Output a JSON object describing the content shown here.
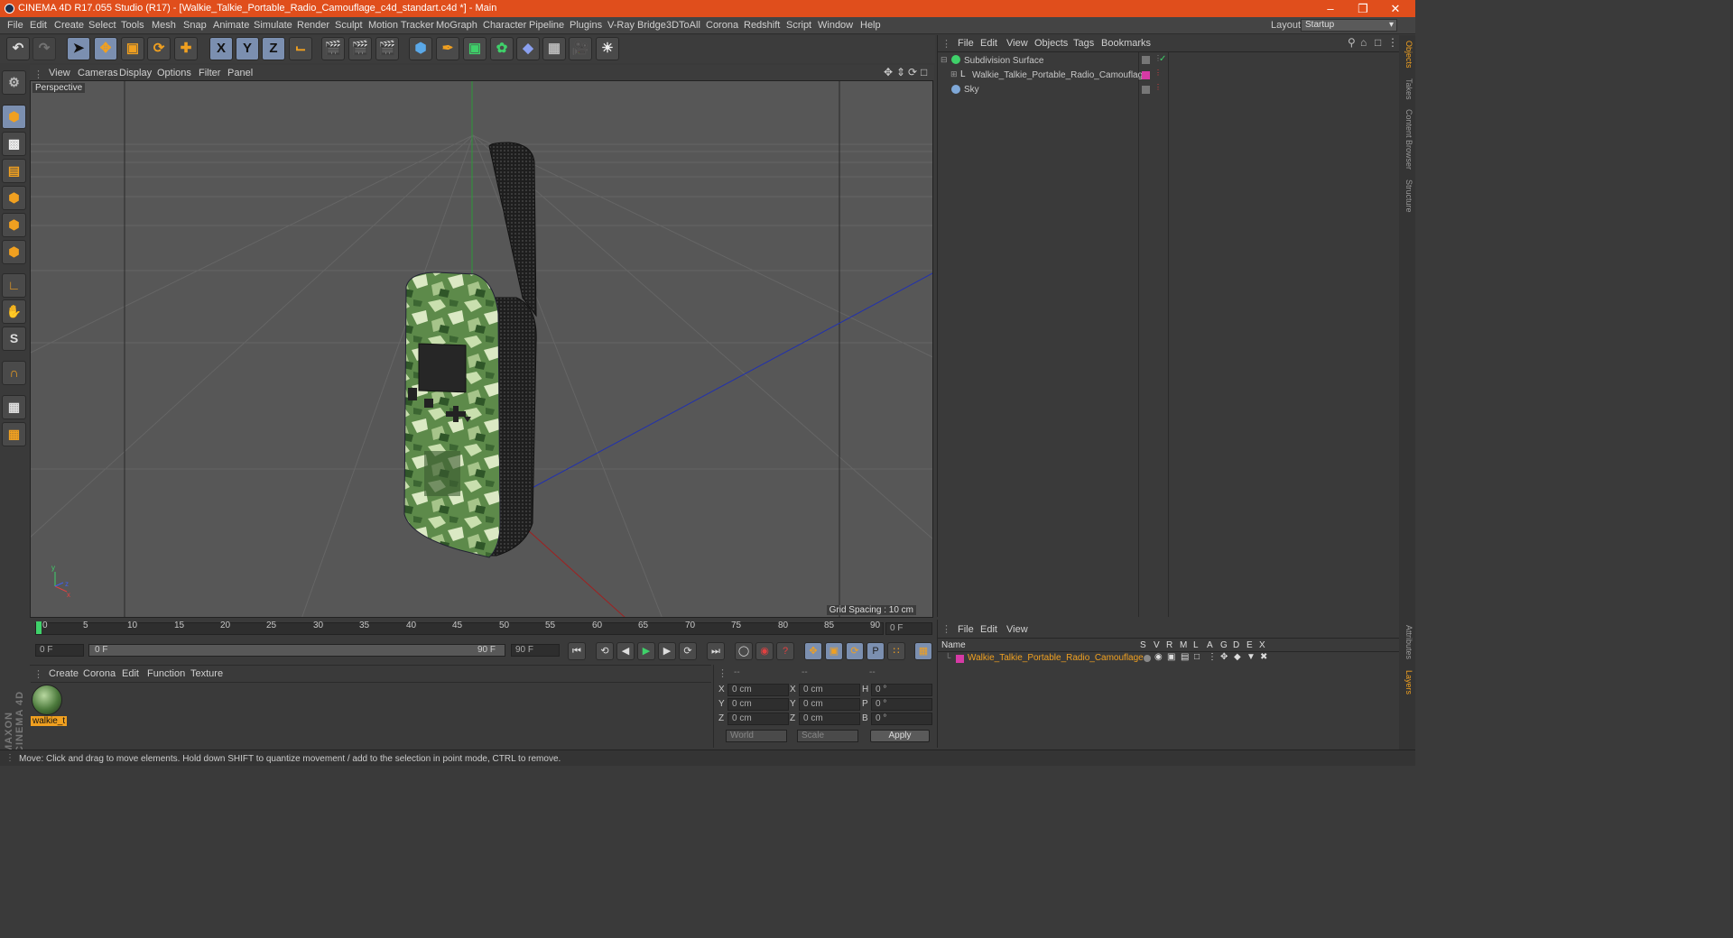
{
  "titlebar": {
    "title": "CINEMA 4D R17.055 Studio (R17) - [Walkie_Talkie_Portable_Radio_Camouflage_c4d_standart.c4d *] - Main",
    "minimize": "–",
    "restore": "❐",
    "close": "✕"
  },
  "menu": {
    "items": [
      "File",
      "Edit",
      "Create",
      "Select",
      "Tools",
      "Mesh",
      "Snap",
      "Animate",
      "Simulate",
      "Render",
      "Sculpt",
      "Motion Tracker",
      "MoGraph",
      "Character",
      "Pipeline",
      "Plugins",
      "V-Ray Bridge",
      "3DToAll",
      "Corona",
      "Redshift",
      "Script",
      "Window",
      "Help"
    ],
    "layout_label": "Layout:",
    "layout_value": "Startup"
  },
  "viewport": {
    "menu": [
      "View",
      "Cameras",
      "Display",
      "Options",
      "Filter",
      "Panel"
    ],
    "title": "Perspective",
    "grid_spacing": "Grid Spacing : 10 cm"
  },
  "timeline": {
    "ticks": [
      "0",
      "5",
      "10",
      "15",
      "20",
      "25",
      "30",
      "35",
      "40",
      "45",
      "50",
      "55",
      "60",
      "65",
      "70",
      "75",
      "80",
      "85",
      "90"
    ],
    "current": "0 F",
    "start": "0 F",
    "range_start": "0 F",
    "range_end": "90 F",
    "end": "90 F"
  },
  "materials": {
    "menu": [
      "Create",
      "Corona",
      "Edit",
      "Function",
      "Texture"
    ],
    "material_name": "walkie_t"
  },
  "coords": {
    "header": [
      "--",
      "--",
      "--"
    ],
    "rows": [
      {
        "a": "X",
        "av": "0 cm",
        "b": "X",
        "bv": "0 cm",
        "c": "H",
        "cv": "0 °"
      },
      {
        "a": "Y",
        "av": "0 cm",
        "b": "Y",
        "bv": "0 cm",
        "c": "P",
        "cv": "0 °"
      },
      {
        "a": "Z",
        "av": "0 cm",
        "b": "Z",
        "bv": "0 cm",
        "c": "B",
        "cv": "0 °"
      }
    ],
    "world": "World",
    "scale": "Scale",
    "apply": "Apply"
  },
  "objects": {
    "menu": [
      "File",
      "Edit",
      "View",
      "Objects",
      "Tags",
      "Bookmarks"
    ],
    "items": [
      "Subdivision Surface",
      "Walkie_Talkie_Portable_Radio_Camouflage",
      "Sky"
    ]
  },
  "layers": {
    "menu": [
      "File",
      "Edit",
      "View"
    ],
    "name_header": "Name",
    "cols": [
      "S",
      "V",
      "R",
      "M",
      "L",
      "A",
      "G",
      "D",
      "E",
      "X"
    ],
    "layer_name": "Walkie_Talkie_Portable_Radio_Camouflage"
  },
  "right_tabs": [
    "Objects",
    "Takes",
    "Content Browser",
    "Structure",
    "Attributes",
    "Layers"
  ],
  "status": "Move: Click and drag to move elements. Hold down SHIFT to quantize movement / add to the selection in point mode, CTRL to remove.",
  "brand": "MAXON CINEMA 4D",
  "colors": {
    "title": "#e04e1c",
    "accent": "#f0a020",
    "layer_color": "#d63aa5",
    "timeline_marker": "#3fd16a"
  }
}
